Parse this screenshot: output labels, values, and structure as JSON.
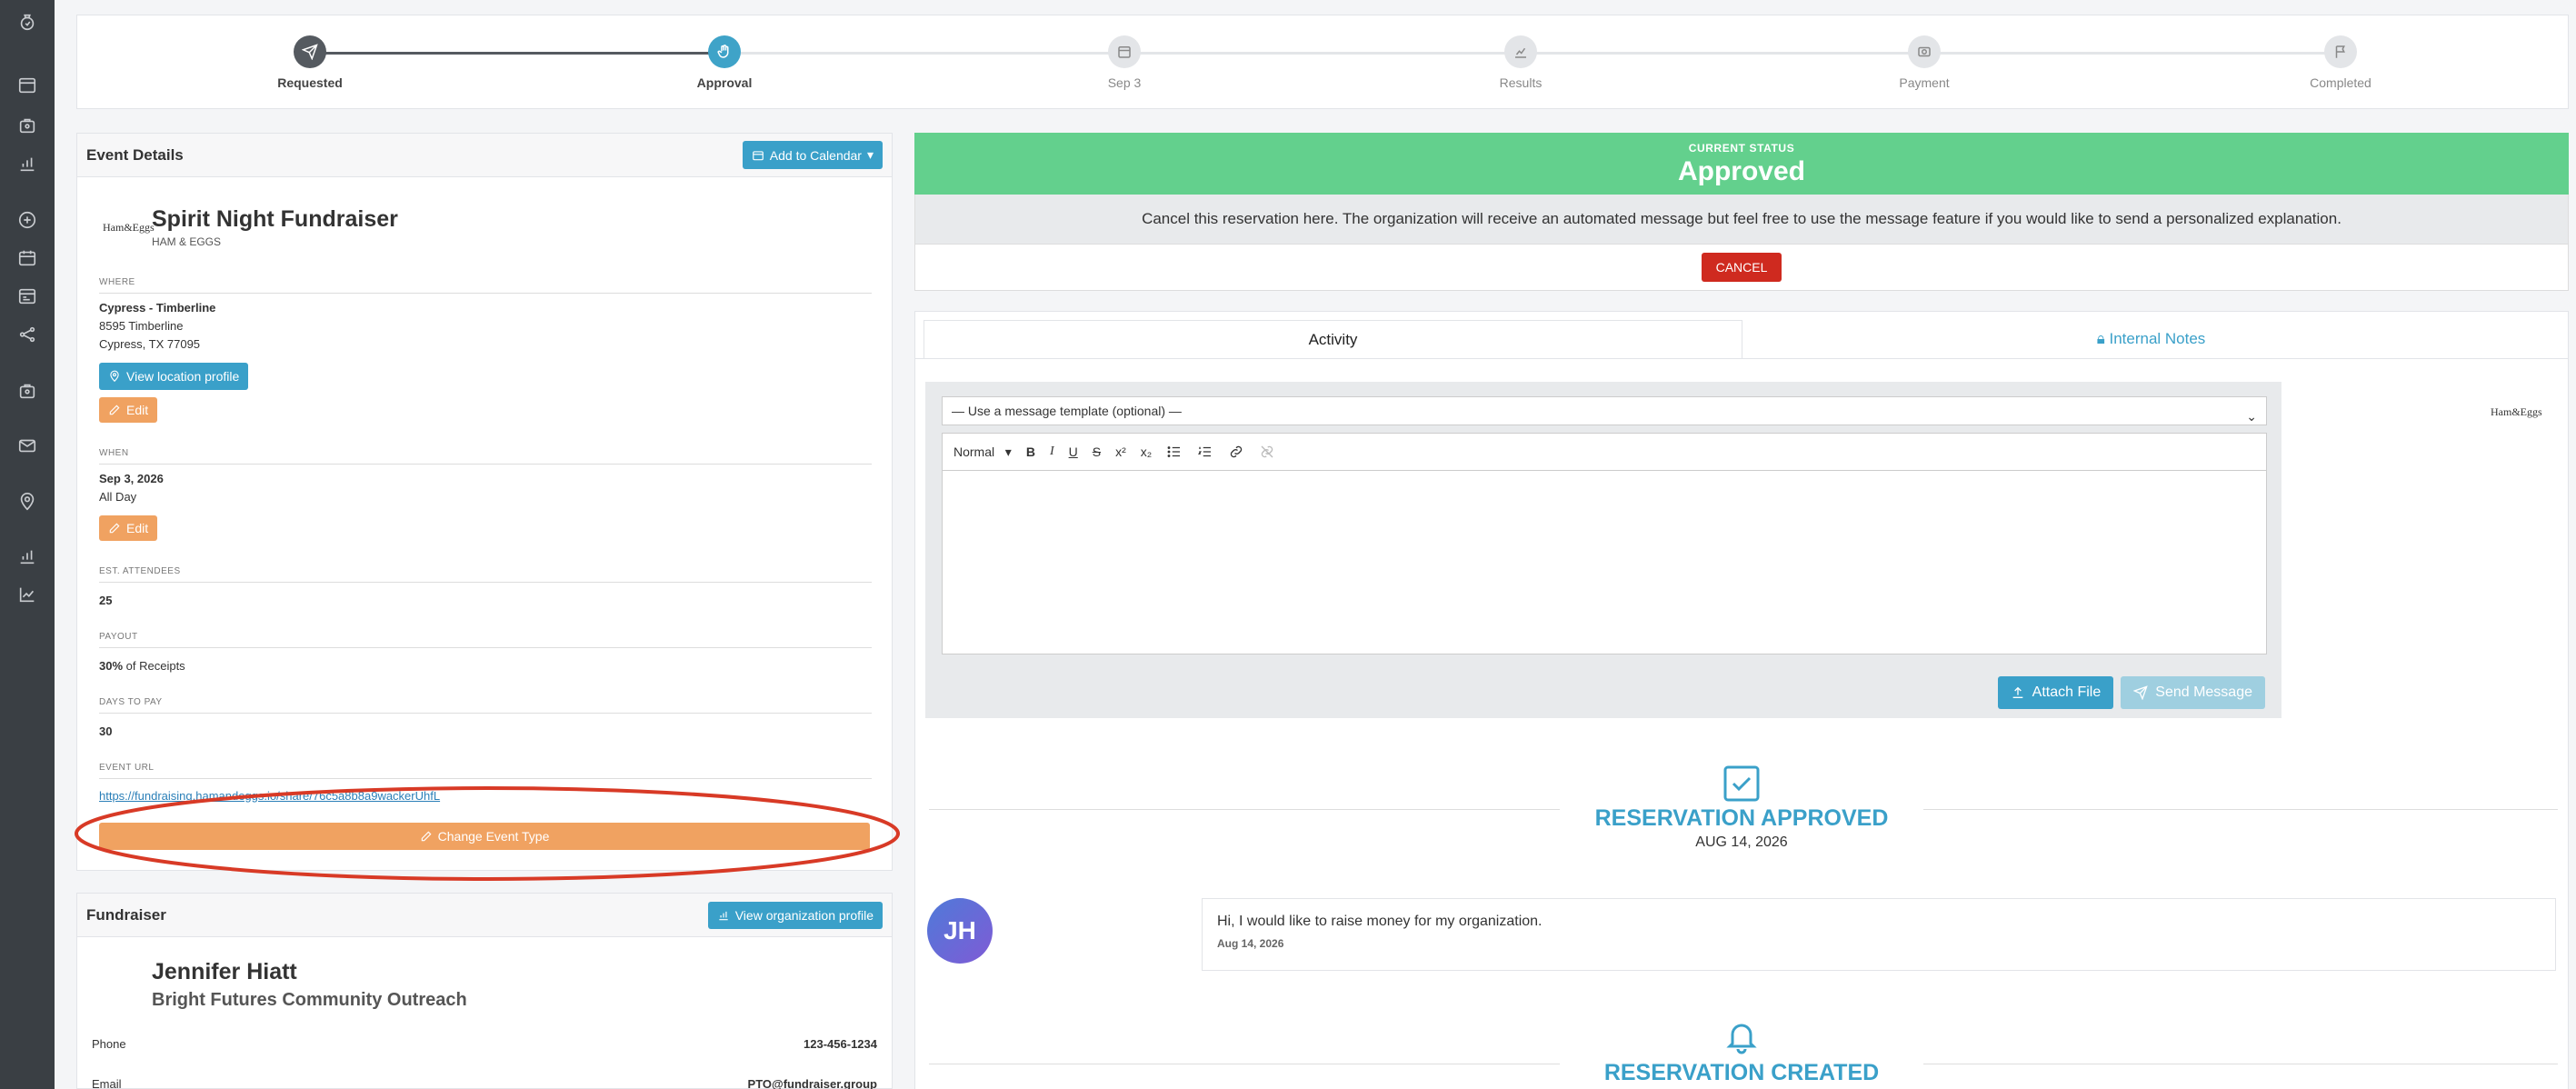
{
  "stepper": {
    "steps": [
      {
        "label": "Requested",
        "state": "done",
        "icon": "send-icon"
      },
      {
        "label": "Approval",
        "state": "active",
        "icon": "hand-icon"
      },
      {
        "label": "Sep 3",
        "state": "pending",
        "icon": "calendar-icon"
      },
      {
        "label": "Results",
        "state": "pending",
        "icon": "chart-icon"
      },
      {
        "label": "Payment",
        "state": "pending",
        "icon": "money-icon"
      },
      {
        "label": "Completed",
        "state": "pending",
        "icon": "flag-icon"
      }
    ]
  },
  "event": {
    "panel_title": "Event Details",
    "add_calendar": "Add to Calendar",
    "logo_text": "Ham&Eggs",
    "name": "Spirit Night Fundraiser",
    "brand": "HAM & EGGS",
    "where_label": "WHERE",
    "location_name": "Cypress - Timberline",
    "address1": "8595 Timberline",
    "address2": "Cypress, TX 77095",
    "view_location": "View location profile",
    "edit": "Edit",
    "when_label": "WHEN",
    "date": "Sep 3, 2026",
    "time": "All Day",
    "attendees_label": "EST. ATTENDEES",
    "attendees": "25",
    "payout_label": "PAYOUT",
    "payout_pct": "30%",
    "payout_rest": " of Receipts",
    "days_label": "DAYS TO PAY",
    "days": "30",
    "url_label": "EVENT URL",
    "url": "https://fundraising.hamandeggs.io/share/76c5a8b8a9wackerUhfL",
    "change_type": "Change Event Type"
  },
  "fundraiser": {
    "panel_title": "Fundraiser",
    "view_org": "View organization profile",
    "name": "Jennifer Hiatt",
    "org": "Bright Futures Community Outreach",
    "phone_label": "Phone",
    "phone": "123-456-1234",
    "email_label": "Email",
    "email": "PTO@fundraiser.group"
  },
  "status": {
    "caption": "CURRENT STATUS",
    "value": "Approved",
    "cancel_text": "Cancel this reservation here. The organization will receive an automated message but feel free to use the message feature if you would like to send a personalized explanation.",
    "cancel_button": "CANCEL"
  },
  "tabs": {
    "activity": "Activity",
    "notes": "Internal Notes"
  },
  "editor": {
    "template_placeholder": "— Use a message template (optional) —",
    "format": "Normal",
    "attach": "Attach File",
    "send": "Send Message",
    "side_logo": "Ham&Eggs"
  },
  "timeline": {
    "approved_title": "RESERVATION APPROVED",
    "approved_date": "AUG 14, 2026",
    "avatar_initials": "JH",
    "message": "Hi, I would like to raise money for my organization.",
    "message_date": "Aug 14, 2026",
    "created_title": "RESERVATION CREATED"
  },
  "colors": {
    "accent": "#3aa0c9",
    "status_green": "#63d08d",
    "cancel_red": "#cf2a1f",
    "orange": "#f0a261",
    "highlight_ring": "#d83a26"
  }
}
